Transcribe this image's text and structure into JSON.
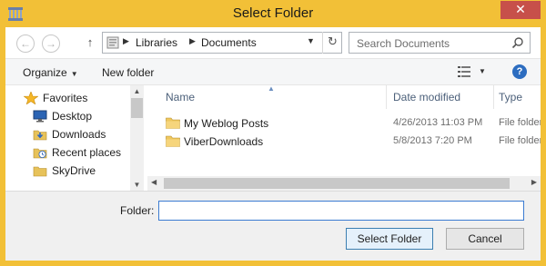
{
  "window": {
    "title": "Select Folder",
    "close_glyph": "✕",
    "accent_color": "#f2c037",
    "app_icon": "library-icon"
  },
  "navigation": {
    "back_glyph": "←",
    "forward_glyph": "→",
    "up_glyph": "↑",
    "breadcrumbs": [
      "Libraries",
      "Documents"
    ],
    "refresh_glyph": "↻"
  },
  "search": {
    "placeholder": "Search Documents"
  },
  "toolbar": {
    "organize_label": "Organize",
    "new_folder_label": "New folder",
    "help_glyph": "?"
  },
  "sidebar": {
    "items": [
      {
        "label": "Favorites",
        "icon": "star-icon"
      },
      {
        "label": "Desktop",
        "icon": "desktop-icon"
      },
      {
        "label": "Downloads",
        "icon": "downloads-icon"
      },
      {
        "label": "Recent places",
        "icon": "recent-places-icon"
      },
      {
        "label": "SkyDrive",
        "icon": "skydrive-icon"
      }
    ]
  },
  "file_list": {
    "columns": [
      "Name",
      "Date modified",
      "Type"
    ],
    "rows": [
      {
        "name": "My Weblog Posts",
        "date": "4/26/2013 11:03 PM",
        "type": "File folder"
      },
      {
        "name": "ViberDownloads",
        "date": "5/8/2013 7:20 PM",
        "type": "File folder"
      }
    ]
  },
  "folder_field": {
    "label": "Folder:",
    "value": ""
  },
  "buttons": {
    "select_label": "Select Folder",
    "cancel_label": "Cancel"
  }
}
